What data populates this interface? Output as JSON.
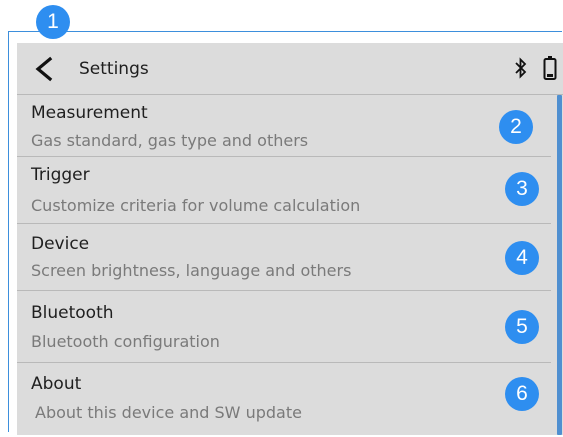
{
  "header": {
    "title": "Settings",
    "back_icon": "chevron-left-icon",
    "bluetooth_icon": "bluetooth-icon",
    "battery_icon": "battery-icon"
  },
  "menu": [
    {
      "label": "Measurement",
      "subtitle": "Gas standard, gas type and others"
    },
    {
      "label": "Trigger",
      "subtitle": "Customize criteria for volume calculation"
    },
    {
      "label": "Device",
      "subtitle": "Screen brightness, language and others"
    },
    {
      "label": "Bluetooth",
      "subtitle": "Bluetooth configuration"
    },
    {
      "label": "About",
      "subtitle": "About this device and SW update"
    }
  ],
  "callouts": [
    "1",
    "2",
    "3",
    "4",
    "5",
    "6"
  ],
  "colors": {
    "callout": "#2e8ef0",
    "screen_background": "#dcdcdc",
    "frame_border": "#3d8fdc",
    "scrollbar": "#4f8fd0"
  }
}
